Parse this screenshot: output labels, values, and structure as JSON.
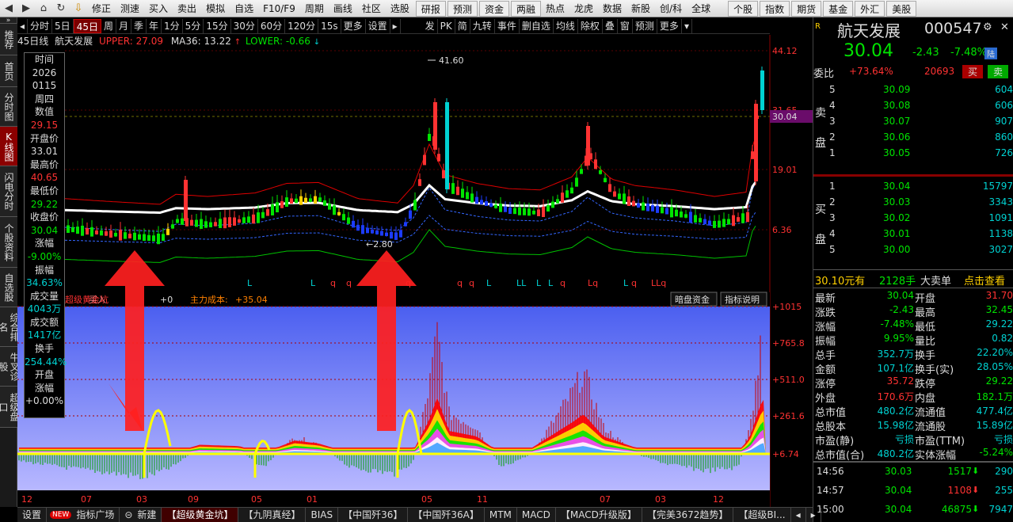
{
  "toolbar": {
    "left": [
      "修正",
      "测速",
      "买入",
      "卖出",
      "模拟",
      "自选",
      "F10/F9",
      "周期",
      "画线",
      "社区",
      "选股"
    ],
    "mid": [
      "研报",
      "预测",
      "资金",
      "两融",
      "热点",
      "龙虎",
      "数据",
      "新股",
      "创/科",
      "全球"
    ],
    "right": [
      "个股",
      "指数",
      "期货",
      "基金",
      "外汇",
      "美股"
    ]
  },
  "leftmenu": [
    {
      "label": "推荐",
      "on": false
    },
    {
      "label": "首页",
      "on": false
    },
    {
      "label": "分时图",
      "on": false
    },
    {
      "label": "K线图",
      "on": true
    },
    {
      "label": "闪电分时",
      "on": false
    },
    {
      "label": "个股资料",
      "on": false
    },
    {
      "label": "自选股",
      "on": false
    },
    {
      "label": "综合排名",
      "on": false
    },
    {
      "label": "牛叉诊股",
      "on": false
    },
    {
      "label": "超级盘口",
      "on": false
    }
  ],
  "period": {
    "items": [
      "分时",
      "5日",
      "45日",
      "周",
      "月",
      "季",
      "年",
      "1分",
      "5分",
      "15分",
      "30分",
      "60分",
      "120分",
      "15s",
      "更多",
      "设置"
    ],
    "active": "45日",
    "tools": [
      "发",
      "PK",
      "简",
      "九转",
      "事件",
      "删自选",
      "均线",
      "除权",
      "叠",
      "窗",
      "预测",
      "更多"
    ]
  },
  "info": {
    "name": "45日线",
    "stock": "航天发展",
    "upper": "UPPER: 27.09",
    "ma": "MA36: 13.22",
    "lower": "LOWER: -0.66"
  },
  "yaxis": {
    "top": [
      "44.12",
      "31.65",
      "19.01",
      "6.36"
    ],
    "price_tag": "30.04",
    "bottom": [
      "+1015",
      "+765.8",
      "+511.0",
      "+261.6",
      "+6.74"
    ]
  },
  "annotations": {
    "high": "41.60",
    "low": "2.80"
  },
  "indicator": {
    "title": "超级黄金坑",
    "buy": "买入",
    "cost_label": "主力成本:",
    "cost": "+35.04",
    "val": "+0",
    "b1": "暗盘资金",
    "b2": "指标说明"
  },
  "xaxis": [
    "12",
    "07",
    "03",
    "09",
    "05",
    "01",
    "05",
    "11",
    "07",
    "03",
    "12"
  ],
  "popup": [
    {
      "k": "时间",
      "v": "2026"
    },
    {
      "k": "",
      "v": "0115"
    },
    {
      "k": "周四",
      "v": ""
    },
    {
      "k": "数值",
      "v": "29.15"
    },
    {
      "k": "开盘价",
      "v": "33.01"
    },
    {
      "k": "最高价",
      "v": "40.65"
    },
    {
      "k": "最低价",
      "v": "29.22"
    },
    {
      "k": "收盘价",
      "v": "30.04"
    },
    {
      "k": "涨幅",
      "v": "-9.00%"
    },
    {
      "k": "振幅",
      "v": "34.63%"
    },
    {
      "k": "成交量",
      "v": "4043万"
    },
    {
      "k": "成交额",
      "v": "1417亿"
    },
    {
      "k": "换手",
      "v": "254.44%"
    },
    {
      "k": "开盘",
      "v": ""
    },
    {
      "k": "涨幅",
      "v": "+0.00%"
    }
  ],
  "quote": {
    "name": "航天发展",
    "code": "000547",
    "price": "30.04",
    "chg": "-2.43",
    "pct": "-7.48%",
    "tag": "陆",
    "weibi_label": "委比",
    "weibi": "+73.64%",
    "weicha": "20693",
    "buy": "买",
    "sell": "卖"
  },
  "asks": [
    {
      "n": "5",
      "p": "30.09",
      "v": "604"
    },
    {
      "n": "4",
      "p": "30.08",
      "v": "606"
    },
    {
      "n": "3",
      "p": "30.07",
      "v": "907"
    },
    {
      "n": "2",
      "p": "30.06",
      "v": "860"
    },
    {
      "n": "1",
      "p": "30.05",
      "v": "726"
    }
  ],
  "bids": [
    {
      "n": "1",
      "p": "30.04",
      "v": "15797"
    },
    {
      "n": "2",
      "p": "30.03",
      "v": "3343"
    },
    {
      "n": "3",
      "p": "30.02",
      "v": "1091"
    },
    {
      "n": "4",
      "p": "30.01",
      "v": "1138"
    },
    {
      "n": "5",
      "p": "30.00",
      "v": "3027"
    }
  ],
  "sell_side": "卖盘",
  "buy_side": "买盘",
  "bigorder": {
    "a": "30.10元有",
    "b": "2128手",
    "c": "大卖单",
    "d": "点击查看"
  },
  "stats": [
    [
      "最新",
      "30.04",
      "开盘",
      "31.70"
    ],
    [
      "涨跌",
      "-2.43",
      "最高",
      "32.45"
    ],
    [
      "涨幅",
      "-7.48%",
      "最低",
      "29.22"
    ],
    [
      "振幅",
      "9.95%",
      "量比",
      "0.82"
    ],
    [
      "总手",
      "352.7万",
      "换手",
      "22.20%"
    ],
    [
      "金额",
      "107.1亿",
      "换手(实)",
      "28.05%"
    ],
    [
      "涨停",
      "35.72",
      "跌停",
      "29.22"
    ],
    [
      "外盘",
      "170.6万",
      "内盘",
      "182.1万"
    ],
    [
      "总市值",
      "480.2亿",
      "流通值",
      "477.4亿"
    ],
    [
      "总股本",
      "15.98亿",
      "流通股",
      "15.89亿"
    ],
    [
      "市盈(静)",
      "亏损",
      "市盈(TTM)",
      "亏损"
    ],
    [
      "总市值(合)",
      "480.2亿",
      "实体涨幅",
      "-5.24%"
    ]
  ],
  "ticks": [
    {
      "t": "14:56",
      "p": "30.03",
      "v": "1517",
      "n": "290"
    },
    {
      "t": "14:57",
      "p": "30.04",
      "v": "1108",
      "n": "255"
    },
    {
      "t": "15:00",
      "p": "30.04",
      "v": "46875",
      "n": "7947"
    }
  ],
  "tabs": [
    "设置",
    "指标广场",
    "新建",
    "【超级黄金坑】",
    "【九阴真经】",
    "BIAS",
    "【中国歼36】",
    "【中国歼36A】",
    "MTM",
    "MACD",
    "【MACD升级版】",
    "【完美3672趋势】",
    "【超级BI..."
  ],
  "tab_active": "【超级黄金坑】",
  "new_badge": "NEW",
  "colors": {
    "up": "#ff3232",
    "down": "#00e400",
    "accent": "#00d2d2",
    "panel": "#4b5ff0"
  }
}
